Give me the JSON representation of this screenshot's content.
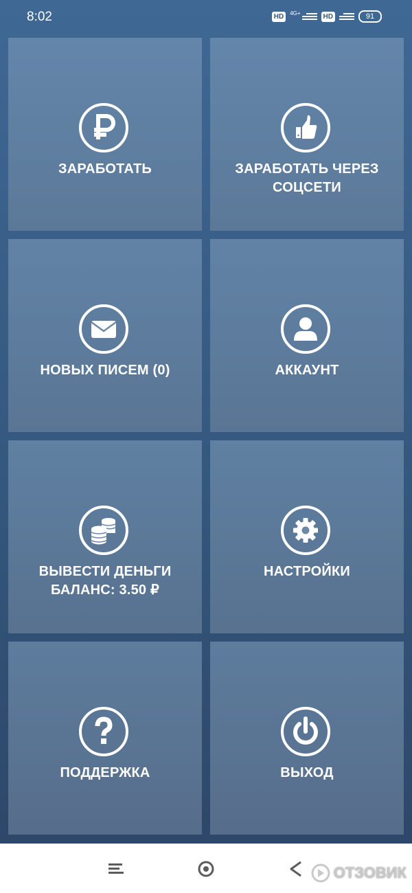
{
  "status_bar": {
    "time": "8:02",
    "hd1": "HD",
    "network": "4G+",
    "hd2": "HD",
    "battery": "91"
  },
  "tiles": [
    {
      "label": "ЗАРАБОТАТЬ",
      "icon": "ruble-icon"
    },
    {
      "label_line1": "ЗАРАБОТАТЬ ЧЕРЕЗ",
      "label_line2": "СОЦСЕТИ",
      "icon": "thumbs-up-icon"
    },
    {
      "label": "НОВЫХ ПИСЕМ (0)",
      "icon": "envelope-icon"
    },
    {
      "label": "АККАУНТ",
      "icon": "user-icon"
    },
    {
      "label_line1": "ВЫВЕСТИ ДЕНЬГИ",
      "label_line2": "БАЛАНС: 3.50 ₽",
      "icon": "coins-icon"
    },
    {
      "label": "НАСТРОЙКИ",
      "icon": "gear-icon"
    },
    {
      "label": "ПОДДЕРЖКА",
      "icon": "question-icon"
    },
    {
      "label": "ВЫХОД",
      "icon": "power-icon"
    }
  ],
  "nav_bar": {
    "buttons": [
      "menu-icon",
      "home-icon",
      "back-icon"
    ]
  },
  "watermark": {
    "text": "ОТЗОВИК"
  },
  "colors": {
    "background": "#34577d",
    "tile_text": "#ffffff",
    "nav_bar": "#ffffff",
    "nav_icons": "#5c5c5c"
  }
}
